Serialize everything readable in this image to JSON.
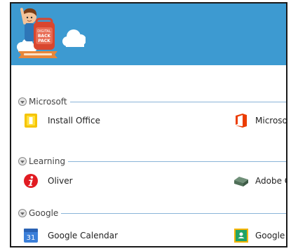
{
  "logo": {
    "badge_line1": "DIGITAL",
    "badge_line2": "BACK",
    "badge_line3": "PACK"
  },
  "sections": [
    {
      "label": "Microsoft",
      "items": [
        {
          "label": "Install Office",
          "icon": "office-install-icon"
        },
        {
          "label": "Microsof",
          "icon": "office-logo-icon"
        }
      ]
    },
    {
      "label": "Learning",
      "items": [
        {
          "label": "Oliver",
          "icon": "oliver-info-icon"
        },
        {
          "label": "Adobe Cr",
          "icon": "adobe-creative-icon"
        }
      ]
    },
    {
      "label": "Google",
      "items": [
        {
          "label": "Google Calendar",
          "icon": "google-calendar-icon"
        },
        {
          "label": "Google C",
          "icon": "google-classroom-icon"
        }
      ]
    }
  ],
  "colors": {
    "header": "#3d9ad1",
    "divider": "#8ab4d8"
  }
}
